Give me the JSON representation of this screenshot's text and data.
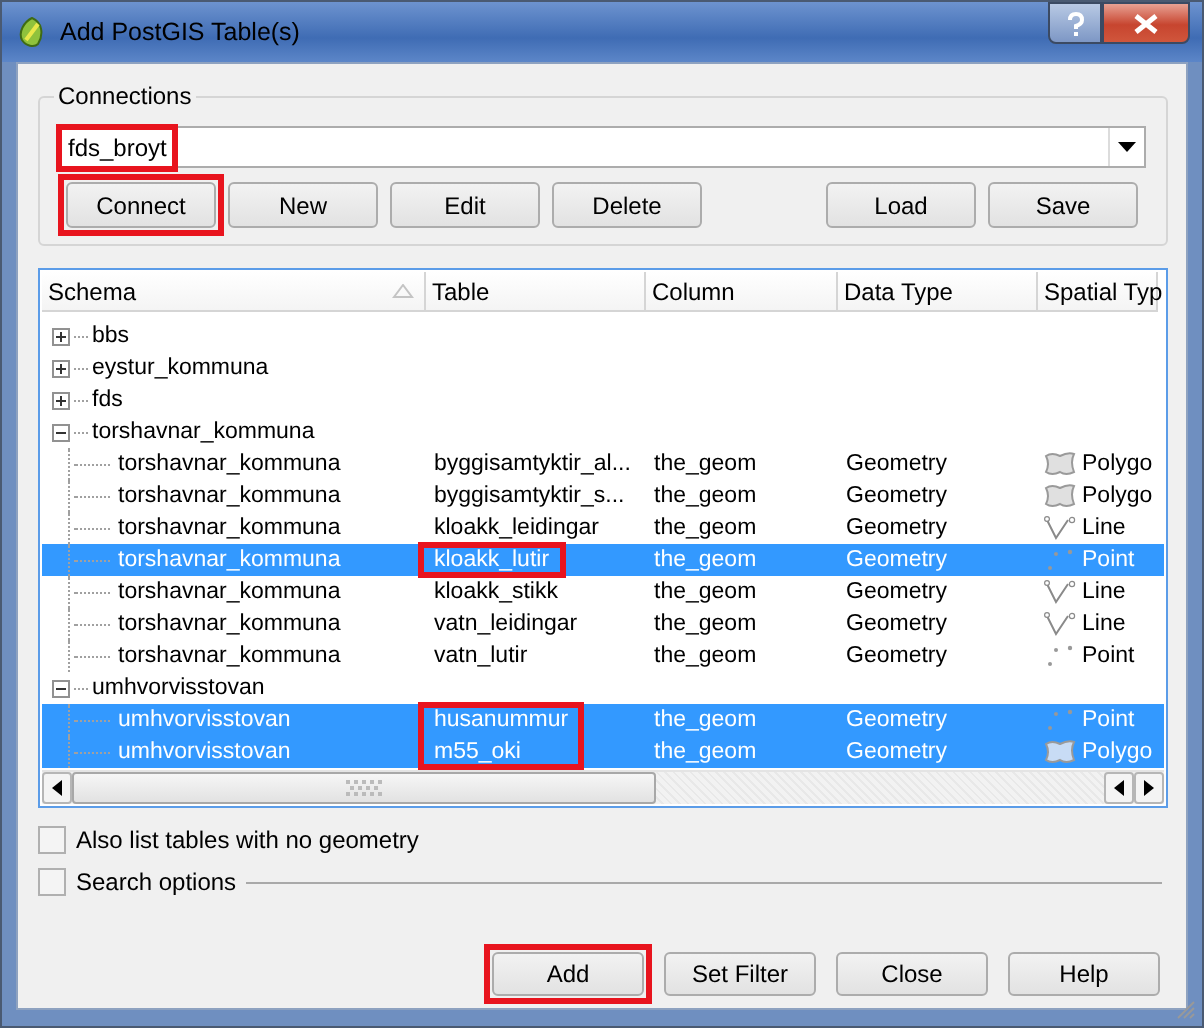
{
  "window": {
    "title": "Add PostGIS Table(s)"
  },
  "connections": {
    "title": "Connections",
    "value": "fds_broyt",
    "highlighted": true,
    "buttons": [
      {
        "label": "Connect",
        "highlighted": true
      },
      {
        "label": "New",
        "highlighted": false
      },
      {
        "label": "Edit",
        "highlighted": false
      },
      {
        "label": "Delete",
        "highlighted": false
      },
      {
        "label": "Load",
        "highlighted": false
      },
      {
        "label": "Save",
        "highlighted": false
      }
    ]
  },
  "table": {
    "columns": [
      "Schema",
      "Table",
      "Column",
      "Data Type",
      "Spatial Typ"
    ],
    "schemas": [
      {
        "name": "bbs",
        "expanded": false
      },
      {
        "name": "eystur_kommuna",
        "expanded": false
      },
      {
        "name": "fds",
        "expanded": false
      },
      {
        "name": "torshavnar_kommuna",
        "expanded": true,
        "children": [
          {
            "schema": "torshavnar_kommuna",
            "table": "byggisamtyktir_al...",
            "column": "the_geom",
            "data_type": "Geometry",
            "spatial_type": "Polygo",
            "kind": "polygon",
            "selected": false,
            "highlighted": false
          },
          {
            "schema": "torshavnar_kommuna",
            "table": "byggisamtyktir_s...",
            "column": "the_geom",
            "data_type": "Geometry",
            "spatial_type": "Polygo",
            "kind": "polygon",
            "selected": false,
            "highlighted": false
          },
          {
            "schema": "torshavnar_kommuna",
            "table": "kloakk_leidingar",
            "column": "the_geom",
            "data_type": "Geometry",
            "spatial_type": "Line",
            "kind": "line",
            "selected": false,
            "highlighted": false
          },
          {
            "schema": "torshavnar_kommuna",
            "table": "kloakk_lutir",
            "column": "the_geom",
            "data_type": "Geometry",
            "spatial_type": "Point",
            "kind": "point",
            "selected": true,
            "highlighted": true
          },
          {
            "schema": "torshavnar_kommuna",
            "table": "kloakk_stikk",
            "column": "the_geom",
            "data_type": "Geometry",
            "spatial_type": "Line",
            "kind": "line",
            "selected": false,
            "highlighted": false
          },
          {
            "schema": "torshavnar_kommuna",
            "table": "vatn_leidingar",
            "column": "the_geom",
            "data_type": "Geometry",
            "spatial_type": "Line",
            "kind": "line",
            "selected": false,
            "highlighted": false
          },
          {
            "schema": "torshavnar_kommuna",
            "table": "vatn_lutir",
            "column": "the_geom",
            "data_type": "Geometry",
            "spatial_type": "Point",
            "kind": "point",
            "selected": false,
            "highlighted": false
          }
        ]
      },
      {
        "name": "umhvorvisstovan",
        "expanded": true,
        "children": [
          {
            "schema": "umhvorvisstovan",
            "table": "husanummur",
            "column": "the_geom",
            "data_type": "Geometry",
            "spatial_type": "Point",
            "kind": "point",
            "selected": true,
            "highlighted": true
          },
          {
            "schema": "umhvorvisstovan",
            "table": "m55_oki",
            "column": "the_geom",
            "data_type": "Geometry",
            "spatial_type": "Polygo",
            "kind": "polygon",
            "selected": true,
            "highlighted": true
          }
        ]
      }
    ]
  },
  "options": [
    {
      "label": "Also list tables with no geometry",
      "checked": false,
      "kind": "checkbox"
    },
    {
      "label": "Search options",
      "checked": false,
      "kind": "group"
    }
  ],
  "buttons": [
    {
      "label": "Add",
      "highlighted": true
    },
    {
      "label": "Set Filter",
      "highlighted": false
    },
    {
      "label": "Close",
      "highlighted": false
    },
    {
      "label": "Help",
      "highlighted": false
    }
  ]
}
